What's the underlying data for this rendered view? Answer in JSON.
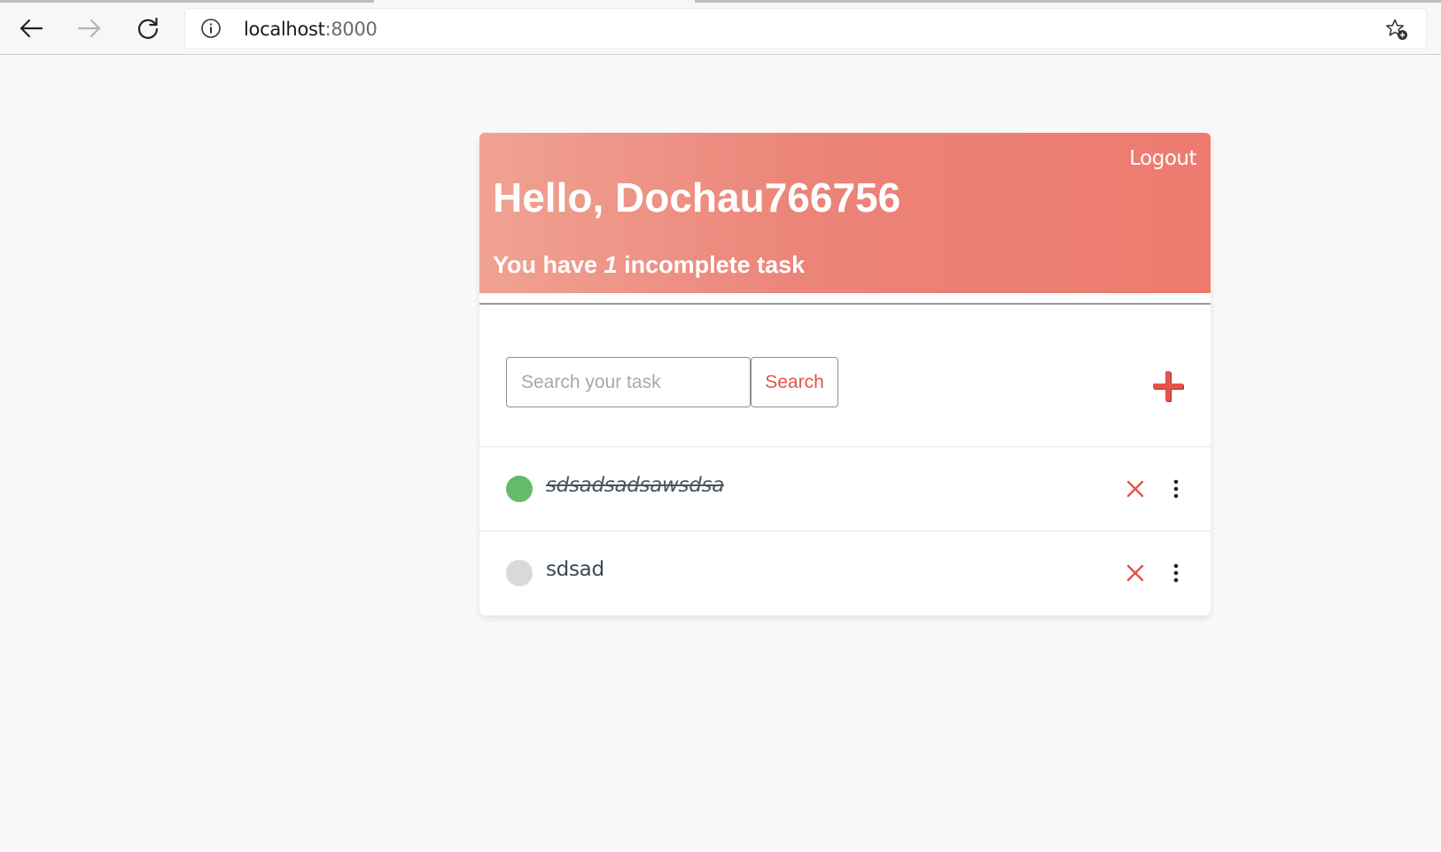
{
  "browser": {
    "url_host": "localhost",
    "url_port": ":8000",
    "icons": {
      "back": "arrow-left-icon",
      "forward": "arrow-right-icon",
      "reload": "reload-icon",
      "info": "info-icon",
      "favorite": "star-add-icon"
    }
  },
  "header": {
    "logout_label": "Logout",
    "greeting": "Hello, Dochau766756",
    "summary_prefix": "You have ",
    "summary_count": "1",
    "summary_suffix": " incomplete task",
    "gradient_start": "#f0a292",
    "gradient_end": "#ee7a6f"
  },
  "search": {
    "placeholder": "Search your task",
    "value": "",
    "button_label": "Search",
    "add_icon": "plus-icon"
  },
  "tasks": [
    {
      "text": "sdsadsadsawsdsa",
      "completed": true,
      "status_color": "#66bb6a"
    },
    {
      "text": "sdsad",
      "completed": false,
      "status_color": "#d9d9d9"
    }
  ],
  "colors": {
    "accent": "#e5534b",
    "done": "#66bb6a",
    "pending": "#d9d9d9"
  }
}
